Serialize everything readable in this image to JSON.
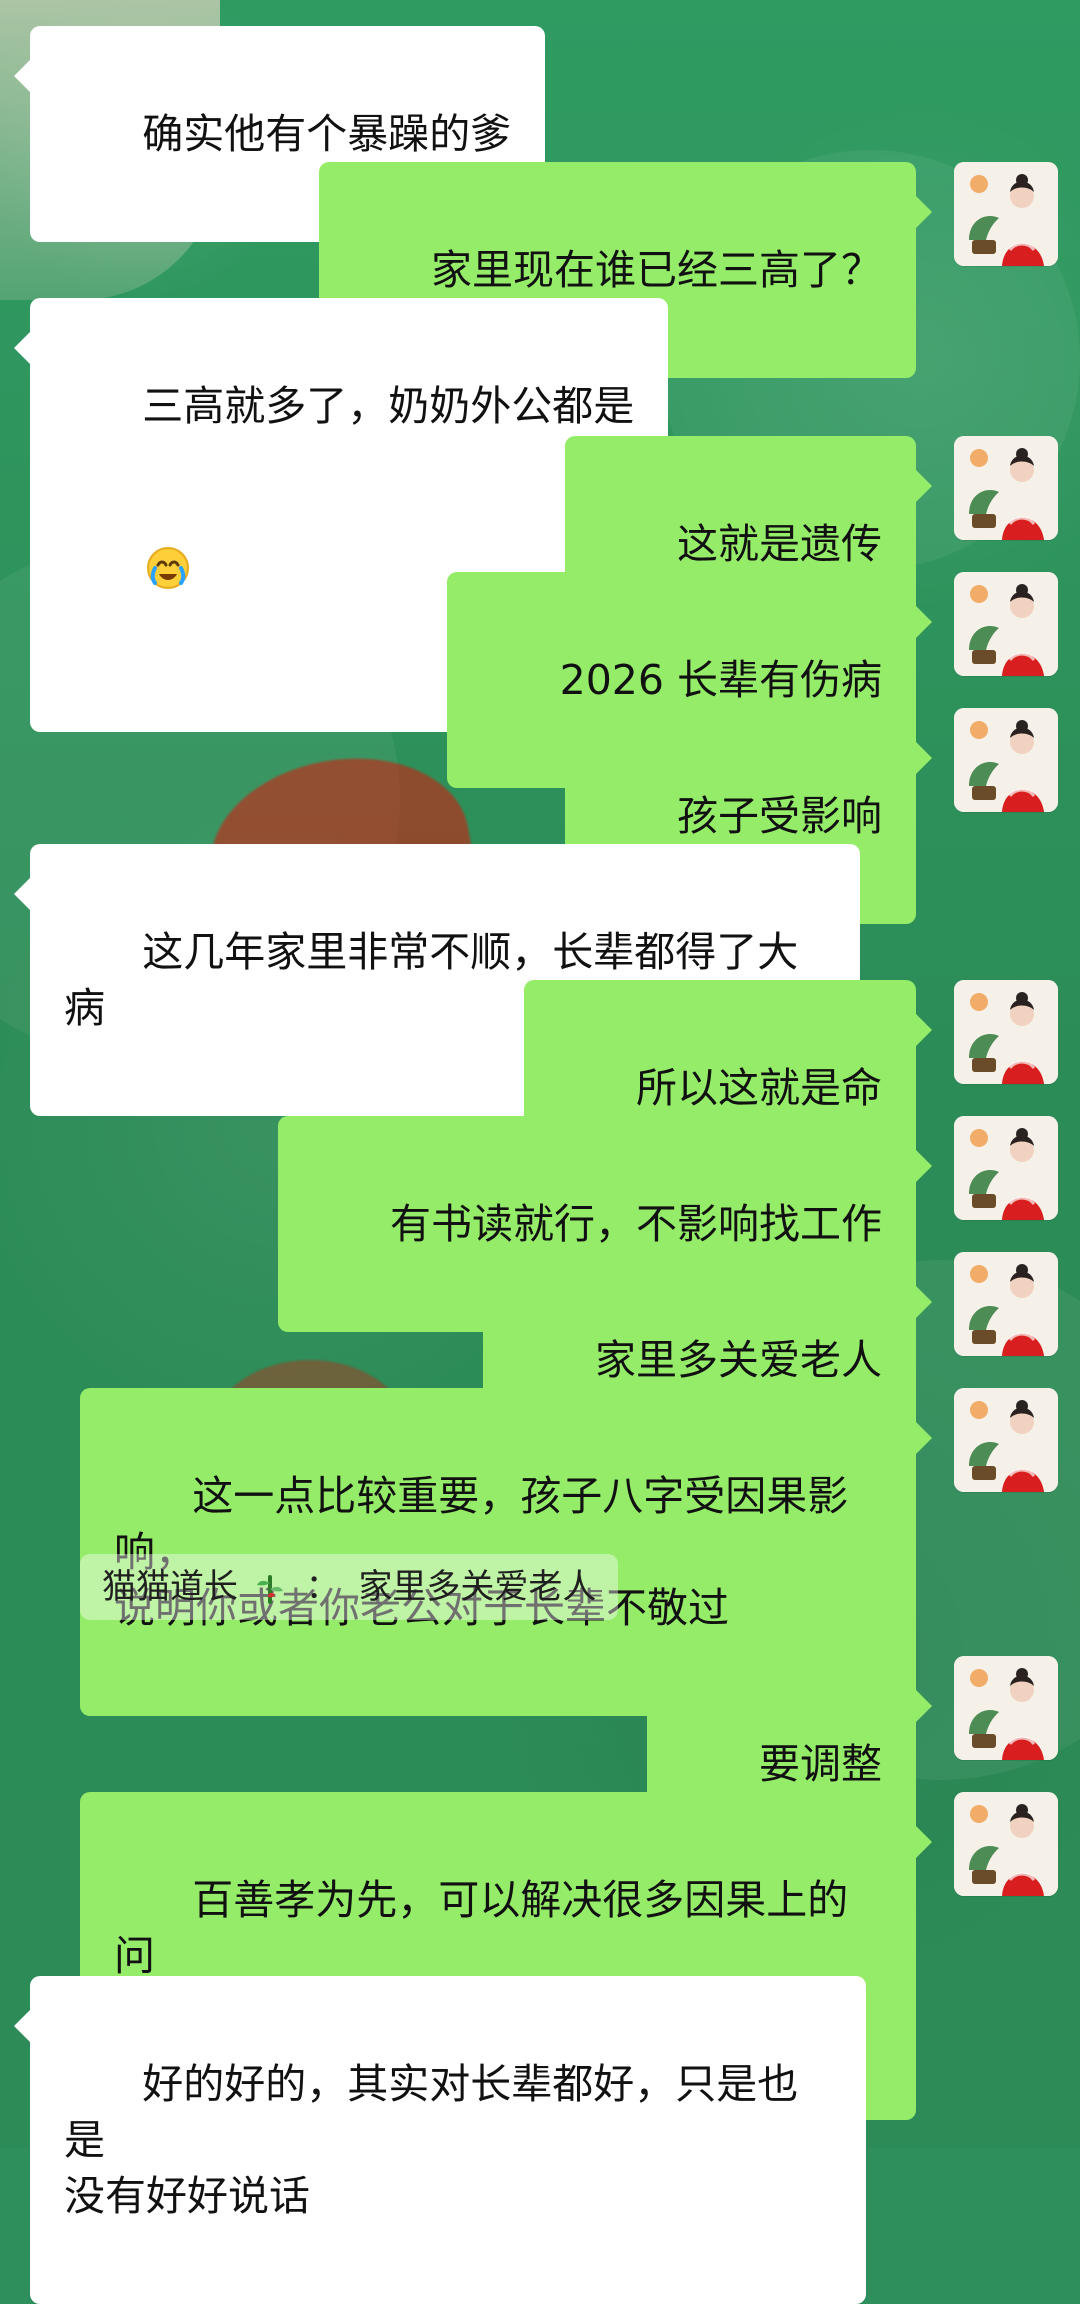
{
  "messages": [
    {
      "side": "left",
      "text": "确实他有个暴躁的爹"
    },
    {
      "side": "right",
      "text": "家里现在谁已经三高了？"
    },
    {
      "side": "left",
      "text": "三高就多了，奶奶外公都是",
      "emoji": "crying-face-emoji"
    },
    {
      "side": "right",
      "text": "这就是遗传"
    },
    {
      "side": "right",
      "text": "2026 长辈有伤病"
    },
    {
      "side": "right",
      "text": "孩子受影响"
    },
    {
      "side": "left",
      "text": "这几年家里非常不顺，长辈都得了大病"
    },
    {
      "side": "right",
      "text": "所以这就是命"
    },
    {
      "side": "right",
      "text": "有书读就行，不影响找工作"
    },
    {
      "side": "right",
      "text": "家里多关爱老人"
    },
    {
      "side": "right",
      "text": "这一点比较重要，孩子八字受因果影响，\n说明你或者你老公对于长辈不敬过"
    },
    {
      "side": "right",
      "text": "要调整"
    },
    {
      "side": "right",
      "text": "百善孝为先，可以解决很多因果上的问\n题"
    },
    {
      "side": "left",
      "text": "好的好的，其实对长辈都好，只是也是\n没有好好说话"
    }
  ],
  "quote": {
    "sender": "猫猫道长",
    "sender_emoji": "bamboo-emoji",
    "separator": "：",
    "text": "家里多关爱老人"
  },
  "colors": {
    "background": "#2e8f5c",
    "bubble_left": "#ffffff",
    "bubble_right": "#95ec69",
    "text": "#111111"
  }
}
